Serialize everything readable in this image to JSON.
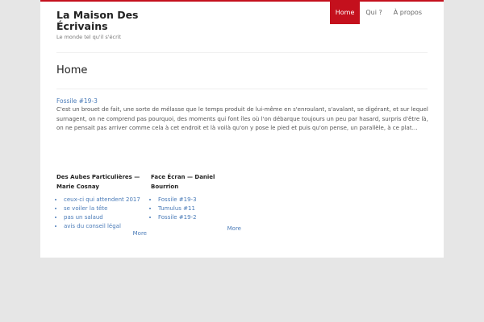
{
  "site": {
    "title": "La Maison Des Écrivains",
    "tagline": "Le monde tel qu'il s'écrit"
  },
  "nav": {
    "items": [
      {
        "label": "Home"
      },
      {
        "label": "Qui ?"
      },
      {
        "label": "À propos"
      }
    ],
    "active": "Home"
  },
  "colors": {
    "accent": "#c4101d",
    "link": "#4a7bb8",
    "background": "#e6e6e6"
  },
  "main": {
    "title": "Home",
    "post": {
      "link": "Fossile #19-3",
      "excerpt": "C'est un brouet de fait, une sorte de mélasse que le temps produit de lui-même en s'enroulant, s'avalant, se digérant, et sur lequel surnagent, on ne comprend pas pourquoi, des moments qui font îles où l'on débarque toujours un peu par hasard, surpris d'être là, on ne pensait pas arriver comme cela à cet endroit et là voilà qu'on y pose le pied et puis qu'on pense, un parallèle, à ce plat…"
    }
  },
  "widgets": [
    {
      "title": "Des Aubes Particulières — Marie Cosnay",
      "items": [
        "ceux-ci qui attendent 2017",
        "se voiler la tête",
        "pas un salaud",
        "avis du conseil légal"
      ],
      "more": "More"
    },
    {
      "title": "Face Écran — Daniel Bourrion",
      "items": [
        "Fossile #19-3",
        "Tumulus #11",
        "Fossile #19-2"
      ],
      "more": "More"
    }
  ]
}
